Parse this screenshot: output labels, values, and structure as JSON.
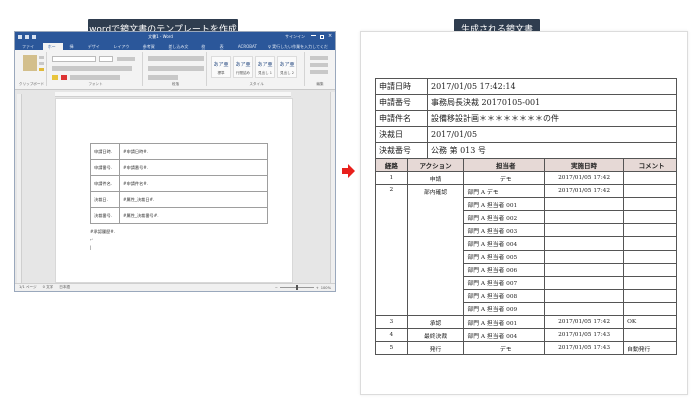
{
  "callouts": {
    "left": "wordで鏡文書のテンプレートを作成",
    "right": "生成される鏡文書"
  },
  "word": {
    "titlebar": "文書1 - Word",
    "signin": "サインイン",
    "tabs": [
      "ファイル",
      "ホーム",
      "挿入",
      "デザイン",
      "レイアウト",
      "参考資料",
      "差し込み文書",
      "校閲",
      "表示",
      "ACROBAT",
      "♀ 実行したい作業を入力してください"
    ],
    "ribbon_groups": [
      "クリップボード",
      "フォント",
      "段落",
      "スタイル",
      "編集"
    ],
    "styles": [
      {
        "sample": "あア亜",
        "label": "標準"
      },
      {
        "sample": "あア亜",
        "label": "行間詰め"
      },
      {
        "sample": "あア亜",
        "label": "見出し 1"
      },
      {
        "sample": "あア亜",
        "label": "見出し 2"
      }
    ],
    "template_rows": [
      {
        "key": "申請日時.",
        "val": "#申請日時#."
      },
      {
        "key": "申請番号.",
        "val": "#申請番号#."
      },
      {
        "key": "申請件名.",
        "val": "#申請件名#."
      },
      {
        "key": "決裁日.",
        "val": "#属性_決裁日#."
      },
      {
        "key": "決裁番号.",
        "val": "#属性_決裁番号#."
      }
    ],
    "after_table": "#承認履歴#.",
    "status": {
      "page": "1/1 ページ",
      "words": "0 文字",
      "lang": "日本語",
      "zoom": "100%"
    }
  },
  "result": {
    "info_rows": [
      {
        "key": "申請日時",
        "val": "2017/01/05 17:42:14"
      },
      {
        "key": "申請番号",
        "val": "事務局長決裁 20170105-001"
      },
      {
        "key": "申請件名",
        "val": "設備移設計画＊＊＊＊＊＊＊＊の件"
      },
      {
        "key": "決裁日",
        "val": "2017/01/05"
      },
      {
        "key": "決裁番号",
        "val": "公務 第 013 号"
      }
    ],
    "history_headers": [
      "経路",
      "アクション",
      "担当者",
      "実施日時",
      "コメント"
    ],
    "history_rows": [
      [
        "1",
        "申請",
        "デモ",
        "2017/01/05 17:42",
        ""
      ],
      [
        "2",
        "部内確認",
        "部門 A デモ",
        "2017/01/05 17:42",
        ""
      ],
      [
        "",
        "",
        "部門 A 担当者 001",
        "",
        ""
      ],
      [
        "",
        "",
        "部門 A 担当者 002",
        "",
        ""
      ],
      [
        "",
        "",
        "部門 A 担当者 003",
        "",
        ""
      ],
      [
        "",
        "",
        "部門 A 担当者 004",
        "",
        ""
      ],
      [
        "",
        "",
        "部門 A 担当者 005",
        "",
        ""
      ],
      [
        "",
        "",
        "部門 A 担当者 006",
        "",
        ""
      ],
      [
        "",
        "",
        "部門 A 担当者 007",
        "",
        ""
      ],
      [
        "",
        "",
        "部門 A 担当者 008",
        "",
        ""
      ],
      [
        "",
        "",
        "部門 A 担当者 009",
        "",
        ""
      ],
      [
        "3",
        "承認",
        "部門 A 担当者 001",
        "2017/01/05 17:42",
        "OK"
      ],
      [
        "4",
        "最終決裁",
        "部門 A 担当者 004",
        "2017/01/05 17:43",
        ""
      ],
      [
        "5",
        "発行",
        "デモ",
        "2017/01/05 17:43",
        "自動発行"
      ]
    ]
  },
  "colors": {
    "callout_bg": "#2f3d4f",
    "word_blue": "#2b579a",
    "arrow_red": "#e8201c",
    "table_header_bg": "#e6d9d6"
  }
}
